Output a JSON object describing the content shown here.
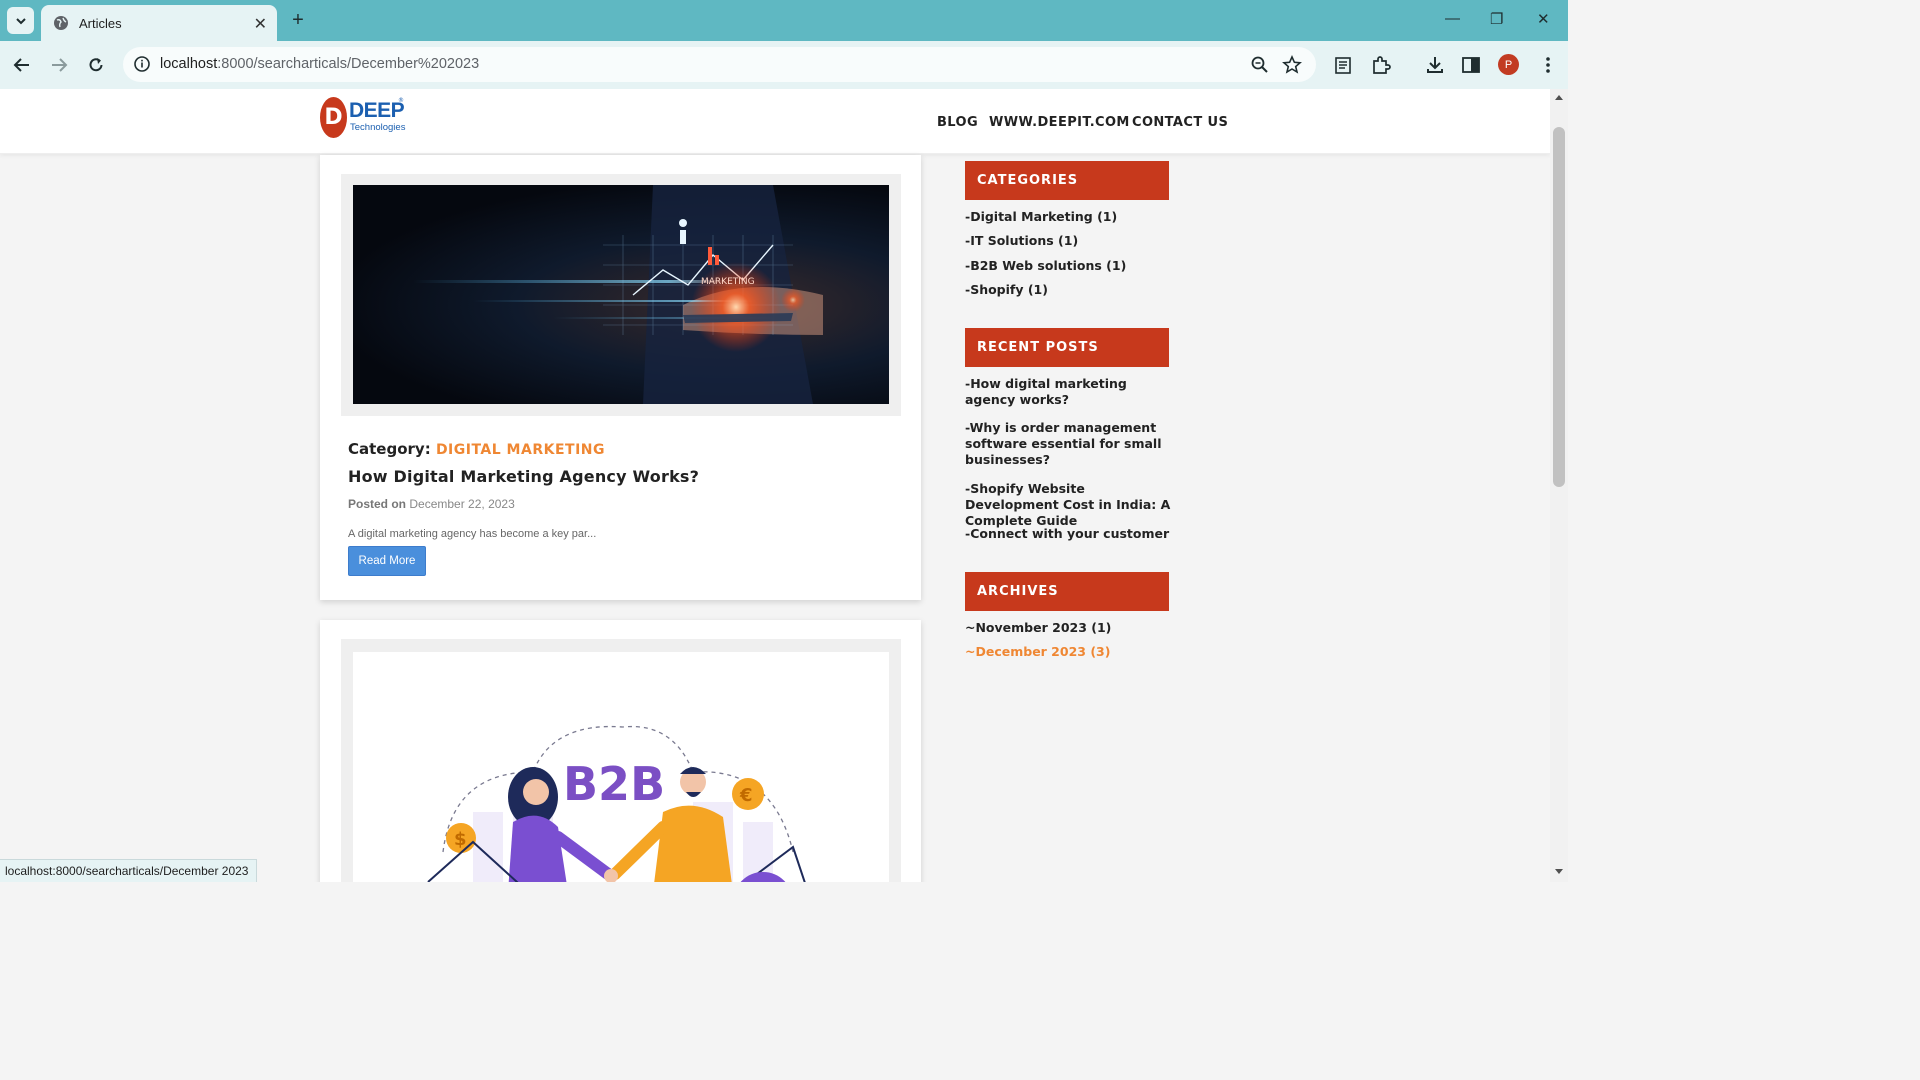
{
  "browser": {
    "tab_title": "Articles",
    "url_host": "localhost",
    "url_rest": ":8000/searcharticals/December%202023",
    "status_url": "localhost:8000/searcharticals/December 2023",
    "profile_initial": "P"
  },
  "site": {
    "logo_letter": "D",
    "logo_name": "DEEP",
    "logo_sub": "Technologies",
    "nav": [
      "BLOG",
      "WWW.DEEPIT.COM",
      "CONTACT US"
    ]
  },
  "posts": [
    {
      "category_label": "Category:",
      "category": "DIGITAL MARKETING",
      "title": "How Digital Marketing Agency Works?",
      "posted_label": "Posted on",
      "date": "December 22, 2023",
      "excerpt": "A digital marketing agency has become a key par...",
      "button": "Read More",
      "image_text": "MARKETING"
    },
    {
      "image_text": "B2B"
    }
  ],
  "sidebar": {
    "categories_title": "CATEGORIES",
    "categories": [
      "-Digital Marketing (1)",
      "-IT Solutions (1)",
      "-B2B Web solutions (1)",
      "-Shopify (1)"
    ],
    "recent_title": "RECENT POSTS",
    "recent": [
      "-How digital marketing agency works?",
      "-Why is order management software essential for small businesses?",
      "-Shopify Website Development Cost in India: A Complete Guide",
      "-Connect with your customer"
    ],
    "archives_title": "ARCHIVES",
    "archives": [
      "~November 2023 (1)",
      "~December 2023 (3)"
    ]
  },
  "colors": {
    "accent_red": "#c7391c",
    "accent_orange": "#ef8733",
    "button_blue": "#4a8fdc",
    "chrome_teal": "#5fb8c2"
  }
}
